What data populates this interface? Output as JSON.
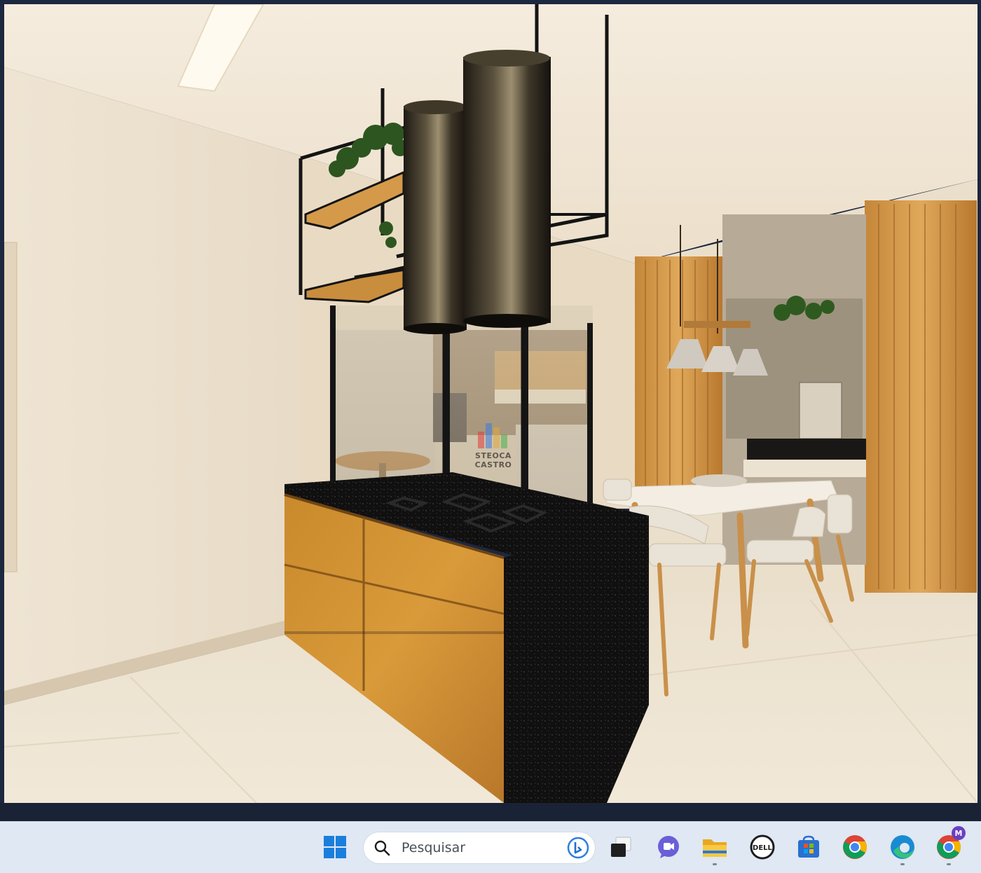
{
  "viewer": {
    "image_subject": "kitchen-island-interior-render",
    "watermark_text": "STEOCA CASTRO"
  },
  "taskbar": {
    "search_placeholder": "Pesquisar",
    "items": [
      {
        "name": "start-button",
        "icon": "windows-logo-icon"
      },
      {
        "name": "search-box",
        "icon": "search-icon"
      },
      {
        "name": "task-view-button",
        "icon": "task-view-icon"
      },
      {
        "name": "teams-chat-button",
        "icon": "chat-icon"
      },
      {
        "name": "file-explorer-button",
        "icon": "folder-icon"
      },
      {
        "name": "dell-button",
        "icon": "dell-icon"
      },
      {
        "name": "microsoft-store-button",
        "icon": "store-icon"
      },
      {
        "name": "chrome-button",
        "icon": "chrome-icon"
      },
      {
        "name": "edge-button",
        "icon": "edge-icon"
      },
      {
        "name": "chrome-profile-button",
        "icon": "chrome-icon"
      }
    ],
    "profile_badge": "M",
    "colors": {
      "background": "#dfe8f3",
      "windows_blue": "#1a7fdc",
      "search_bg": "#ffffff"
    }
  }
}
